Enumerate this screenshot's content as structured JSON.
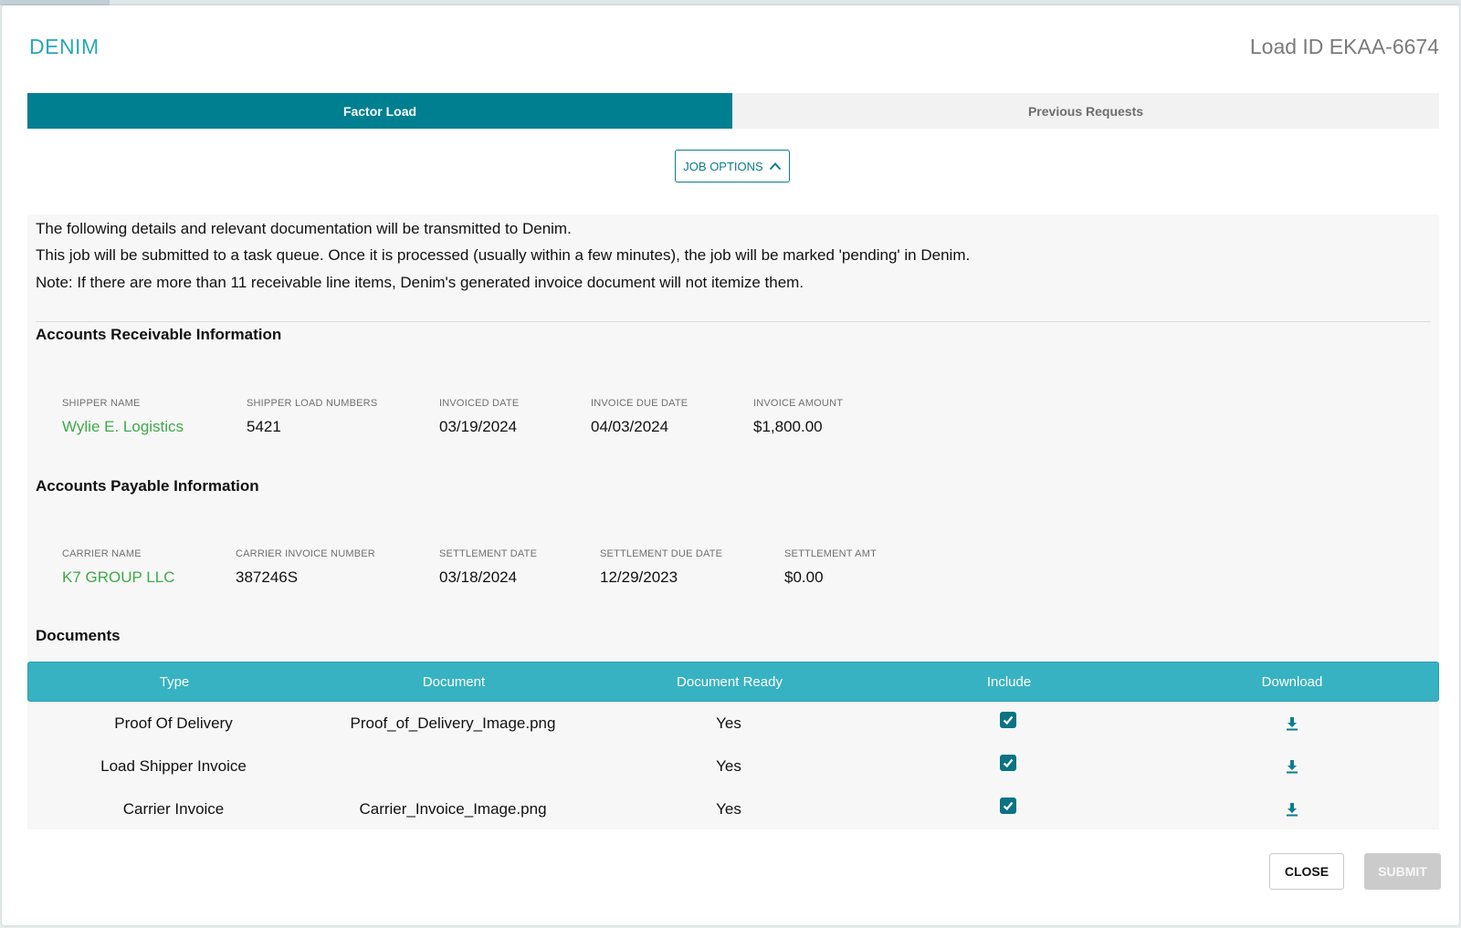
{
  "header": {
    "brand": "DENIM",
    "load_id": "Load ID EKAA-6674"
  },
  "tabs": [
    {
      "label": "Factor Load",
      "active": true
    },
    {
      "label": "Previous Requests",
      "active": false
    }
  ],
  "job_options": {
    "label": "JOB OPTIONS",
    "icon": "chevron-up-icon"
  },
  "info": {
    "line1": "The following details and relevant documentation will be transmitted to Denim.",
    "line2": "This job will be submitted to a task queue. Once it is processed (usually within a few minutes), the job will be marked 'pending' in Denim.",
    "line3": "Note: If there are more than 11 receivable line items, Denim's generated invoice document will not itemize them."
  },
  "receivable": {
    "title": "Accounts Receivable Information",
    "fields": [
      {
        "label": "SHIPPER NAME",
        "value": "Wylie E. Logistics"
      },
      {
        "label": "SHIPPER LOAD NUMBERS",
        "value": "5421"
      },
      {
        "label": "INVOICED DATE",
        "value": "03/19/2024"
      },
      {
        "label": "INVOICE DUE DATE",
        "value": "04/03/2024"
      },
      {
        "label": "INVOICE AMOUNT",
        "value": "$1,800.00"
      }
    ]
  },
  "payable": {
    "title": "Accounts Payable Information",
    "fields": [
      {
        "label": "CARRIER NAME",
        "value": "K7 GROUP LLC"
      },
      {
        "label": "CARRIER INVOICE NUMBER",
        "value": "387246S"
      },
      {
        "label": "SETTLEMENT DATE",
        "value": "03/18/2024"
      },
      {
        "label": "SETTLEMENT DUE DATE",
        "value": "12/29/2023"
      },
      {
        "label": "SETTLEMENT AMT",
        "value": "$0.00"
      }
    ]
  },
  "documents": {
    "title": "Documents",
    "columns": [
      "Type",
      "Document",
      "Document Ready",
      "Include",
      "Download"
    ],
    "rows": [
      {
        "type": "Proof Of Delivery",
        "document": "Proof_of_Delivery_Image.png",
        "ready": "Yes",
        "include": true
      },
      {
        "type": "Load Shipper Invoice",
        "document": "",
        "ready": "Yes",
        "include": true
      },
      {
        "type": "Carrier Invoice",
        "document": "Carrier_Invoice_Image.png",
        "ready": "Yes",
        "include": true
      }
    ]
  },
  "footer": {
    "close_label": "CLOSE",
    "submit_label": "SUBMIT"
  },
  "colors": {
    "brand": "#2aa8b8",
    "active_tab": "#007f90",
    "table_header": "#37b2c2",
    "link_green": "#3fa94a",
    "checkbox": "#0b7383"
  }
}
